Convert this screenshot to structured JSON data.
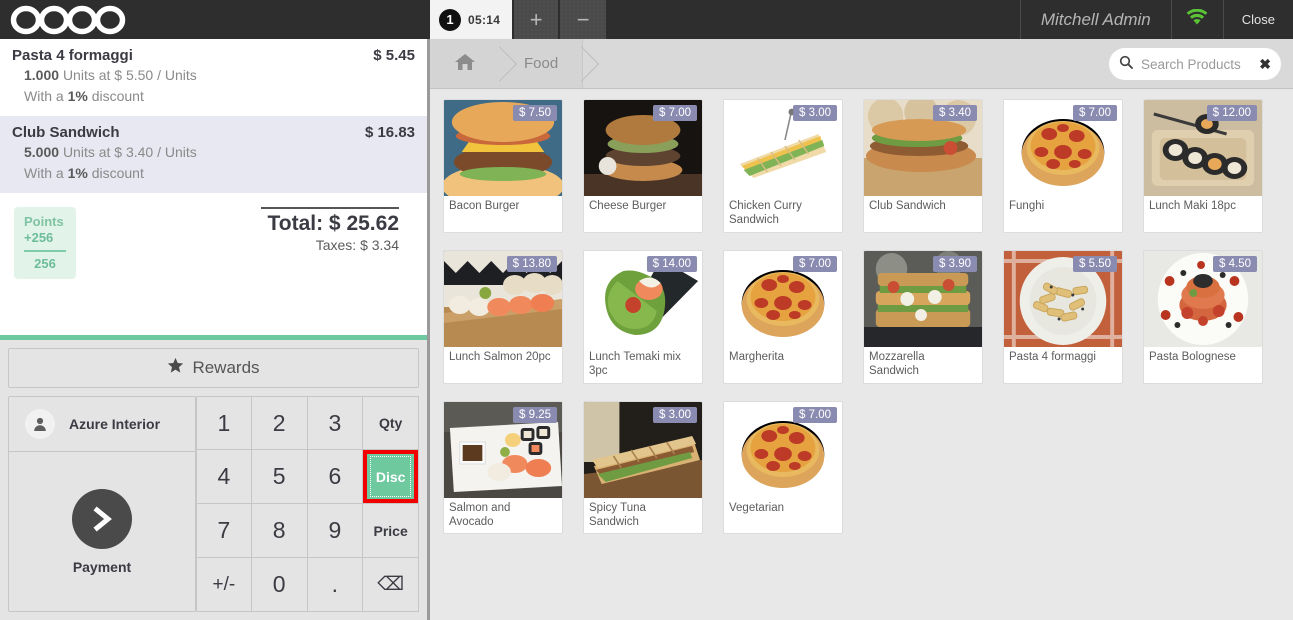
{
  "brand": {
    "name": "odoo"
  },
  "topbar": {
    "order_number": "1",
    "order_time": "05:14",
    "add_order_label": "+",
    "remove_order_label": "−",
    "user_name": "Mitchell Admin",
    "wifi_icon": "wifi-icon",
    "close_label": "Close"
  },
  "order": {
    "lines": [
      {
        "name": "Pasta 4 formaggi",
        "price": "$ 5.45",
        "qty_text": "1.000",
        "unit_text": "Units at $ 5.50 / Units",
        "discount_prefix": "With a",
        "discount_value": "1%",
        "discount_suffix": "discount",
        "selected": false
      },
      {
        "name": "Club Sandwich",
        "price": "$ 16.83",
        "qty_text": "5.000",
        "unit_text": "Units at $ 3.40 / Units",
        "discount_prefix": "With a",
        "discount_value": "1%",
        "discount_suffix": "discount",
        "selected": true
      }
    ],
    "points": {
      "title": "Points",
      "delta": "+256",
      "total": "256"
    },
    "total_label": "Total: $ 25.62",
    "taxes_label": "Taxes: $ 3.34"
  },
  "pad": {
    "rewards_label": "Rewards",
    "star_icon": "star-icon",
    "customer_name": "Azure Interior",
    "customer_icon": "person-icon",
    "payment_label": "Payment",
    "payment_icon": "chevron-right-icon",
    "keys": {
      "k1": "1",
      "k2": "2",
      "k3": "3",
      "qty": "Qty",
      "k4": "4",
      "k5": "5",
      "k6": "6",
      "disc": "Disc",
      "k7": "7",
      "k8": "8",
      "k9": "9",
      "price": "Price",
      "sign": "+/-",
      "k0": "0",
      "dot": ".",
      "backspace": "⌫"
    },
    "highlight_color": "#f20000",
    "active_key_color": "#6ec99f"
  },
  "catalog": {
    "breadcrumb": {
      "home_icon": "home-icon",
      "category": "Food"
    },
    "search": {
      "placeholder": "Search Products",
      "value": "",
      "icon": "search-icon",
      "clear_icon": "close-icon"
    },
    "products": [
      {
        "name": "Bacon Burger",
        "price": "$ 7.50",
        "art": "bacon-burger"
      },
      {
        "name": "Cheese Burger",
        "price": "$ 7.00",
        "art": "cheese-burger"
      },
      {
        "name": "Chicken Curry Sandwich",
        "price": "$ 3.00",
        "art": "curry-sandwich"
      },
      {
        "name": "Club Sandwich",
        "price": "$ 3.40",
        "art": "club-sandwich"
      },
      {
        "name": "Funghi",
        "price": "$ 7.00",
        "art": "pizza"
      },
      {
        "name": "Lunch Maki 18pc",
        "price": "$ 12.00",
        "art": "maki"
      },
      {
        "name": "Lunch Salmon 20pc",
        "price": "$ 13.80",
        "art": "salmon-sushi"
      },
      {
        "name": "Lunch Temaki mix 3pc",
        "price": "$ 14.00",
        "art": "temaki"
      },
      {
        "name": "Margherita",
        "price": "$ 7.00",
        "art": "pizza"
      },
      {
        "name": "Mozzarella Sandwich",
        "price": "$ 3.90",
        "art": "mozzarella"
      },
      {
        "name": "Pasta 4 formaggi",
        "price": "$ 5.50",
        "art": "pasta-white"
      },
      {
        "name": "Pasta Bolognese",
        "price": "$ 4.50",
        "art": "pasta-red"
      },
      {
        "name": "Salmon and Avocado",
        "price": "$ 9.25",
        "art": "sushi-plate"
      },
      {
        "name": "Spicy Tuna Sandwich",
        "price": "$ 3.00",
        "art": "panini"
      },
      {
        "name": "Vegetarian",
        "price": "$ 7.00",
        "art": "pizza"
      }
    ]
  }
}
